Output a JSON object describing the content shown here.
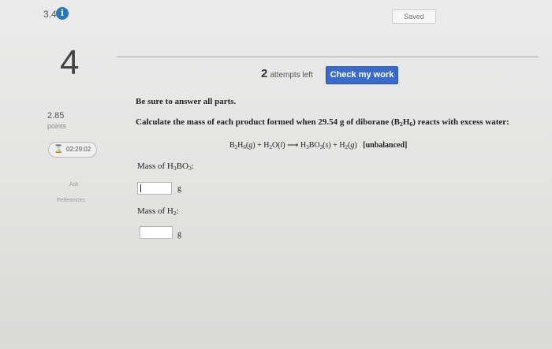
{
  "header": {
    "question_number": "3.4",
    "info_symbol": "i",
    "saved_label": "Saved"
  },
  "question": {
    "big_number": "4",
    "attempts_count": "2",
    "attempts_label": "attempts left",
    "check_button_label": "Check my work",
    "instruction": "Be sure to answer all parts.",
    "text_before_formula": "Calculate the mass of each product formed when 29.54 g of diborane (",
    "text_after_formula": ") reacts with excess water:",
    "equation_suffix": "[unbalanced]"
  },
  "sidebar": {
    "points_value": "2.85",
    "points_label": "points",
    "timer_icon": "hourglass-icon",
    "timer": "02:29:02",
    "ask_label": "Ask",
    "references_label": "References"
  },
  "answers": [
    {
      "label_prefix": "Mass of ",
      "label_suffix": ":",
      "value": "",
      "unit": "g"
    },
    {
      "label_prefix": "Mass of ",
      "label_suffix": ":",
      "value": "",
      "unit": "g"
    }
  ],
  "colors": {
    "accent": "#3a6bc8",
    "info_icon": "#2a78b5",
    "timer_icon": "#4caf50",
    "background": "#e6e6e5"
  }
}
